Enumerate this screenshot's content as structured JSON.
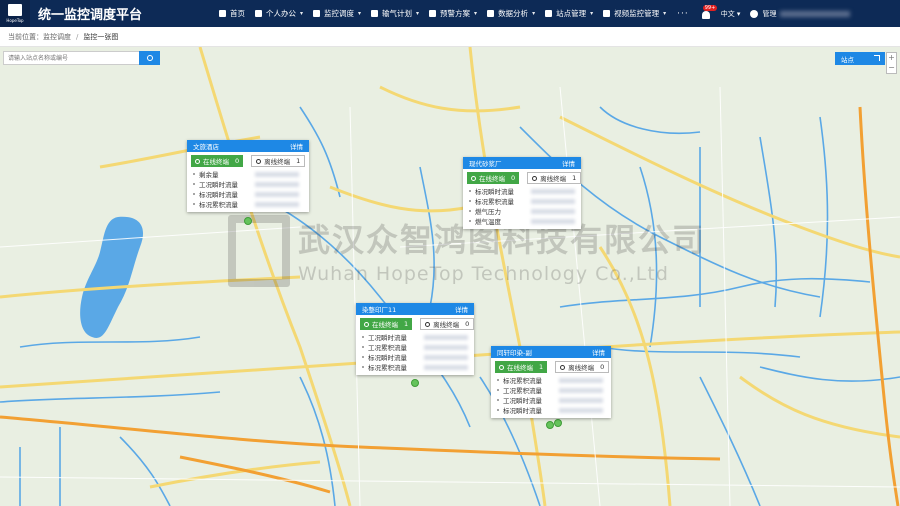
{
  "header": {
    "logo_text": "HopeTop",
    "title": "统一监控调度平台",
    "nav": [
      {
        "label": "首页",
        "icon": "home-icon",
        "caret": false
      },
      {
        "label": "个人办公",
        "icon": "person-icon",
        "caret": true
      },
      {
        "label": "监控调度",
        "icon": "monitor-icon",
        "caret": true
      },
      {
        "label": "输气计划",
        "icon": "plan-icon",
        "caret": true
      },
      {
        "label": "预警方案",
        "icon": "alert-icon",
        "caret": true
      },
      {
        "label": "数据分析",
        "icon": "chart-icon",
        "caret": true
      },
      {
        "label": "站点管理",
        "icon": "site-icon",
        "caret": true
      },
      {
        "label": "视频监控管理",
        "icon": "video-icon",
        "caret": true
      }
    ],
    "more": "···",
    "bell_badge": "99+",
    "language": "中文 ▾",
    "user_label": "管理"
  },
  "breadcrumb": {
    "prefix": "当前位置：",
    "items": [
      "监控调度",
      "监控一张图"
    ]
  },
  "map": {
    "search_placeholder": "请输入站点名称或编号",
    "site_button": "站点",
    "zoom_in": "+",
    "zoom_out": "−"
  },
  "watermark": {
    "cn": "武汉众智鸿图科技有限公司",
    "en": "Wuhan HopeTop Technology Co.,Ltd"
  },
  "popups": [
    {
      "title": "文旅酒店",
      "detail": "详情",
      "online": "在线终端",
      "online_count": "0",
      "offline": "离线终端",
      "offline_count": "1",
      "rows": [
        "剩余量",
        "工况瞬时流量",
        "标况瞬时流量",
        "标况累积流量"
      ]
    },
    {
      "title": "现代砂浆厂",
      "detail": "详情",
      "online": "在线终端",
      "online_count": "0",
      "offline": "离线终端",
      "offline_count": "1",
      "rows": [
        "标况瞬时流量",
        "标况累积流量",
        "燃气压力",
        "燃气温度"
      ]
    },
    {
      "title": "染整印厂11",
      "detail": "详情",
      "online": "在线终端",
      "online_count": "1",
      "offline": "离线终端",
      "offline_count": "0",
      "rows": [
        "工况瞬时流量",
        "工况累积流量",
        "标况瞬时流量",
        "标况累积流量"
      ]
    },
    {
      "title": "同轩印染-副",
      "detail": "详情",
      "online": "在线终端",
      "online_count": "1",
      "offline": "离线终端",
      "offline_count": "0",
      "rows": [
        "标况累积流量",
        "工况累积流量",
        "工况瞬时流量",
        "标况瞬时流量"
      ]
    }
  ]
}
